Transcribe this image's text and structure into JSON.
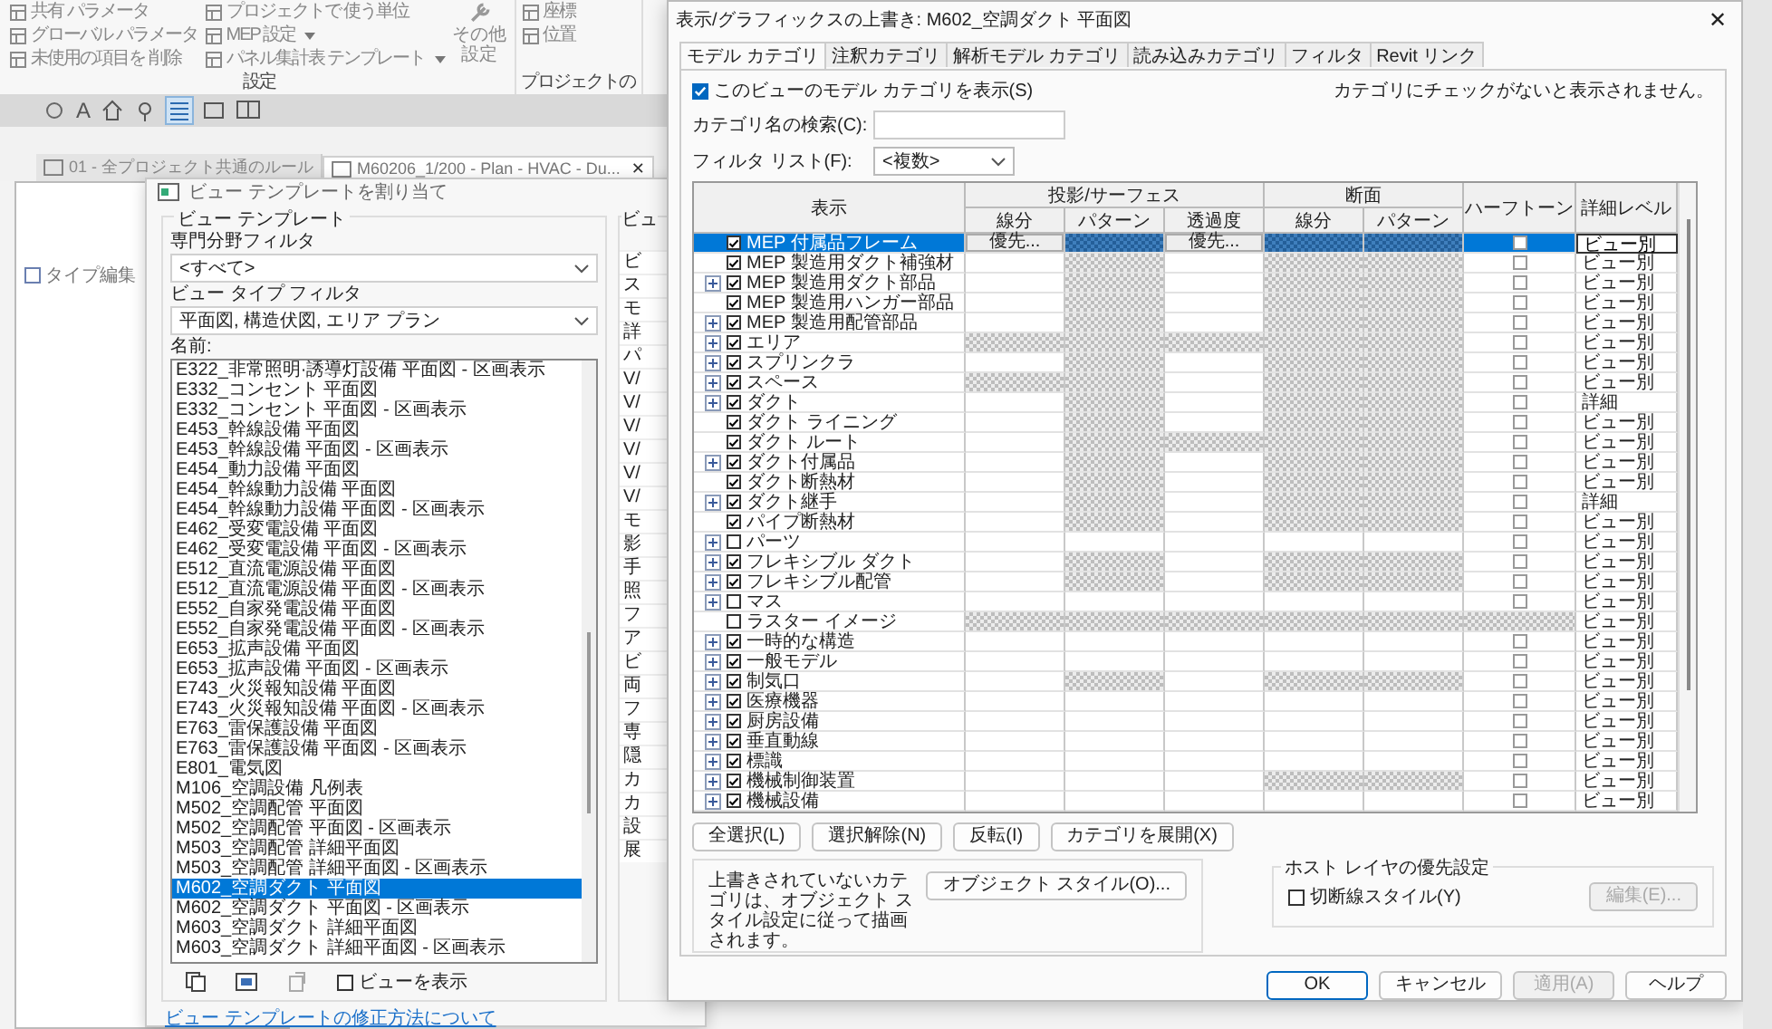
{
  "app": {
    "ribbon": {
      "groups": [
        {
          "label": "設定",
          "items": [
            {
              "label": "共有 パラメータ",
              "dropdown": false
            },
            {
              "label": "グローバル パラメータ",
              "dropdown": false
            },
            {
              "label": "未使用の項目を 削除",
              "dropdown": false
            },
            {
              "label": "プロジェクトで 使う単位",
              "dropdown": false
            },
            {
              "label": "MEP 設定",
              "dropdown": true
            },
            {
              "label": "パネル集計表 テンプレート",
              "dropdown": true
            }
          ],
          "big": "その他設定"
        },
        {
          "label": "プロジェクトの",
          "items": [
            {
              "label": "座標",
              "dropdown": false
            },
            {
              "label": "位置",
              "dropdown": false
            }
          ]
        }
      ]
    },
    "toolbar": {
      "text_tool": "A"
    },
    "doc_tabs": [
      {
        "label": "01 - 全プロジェクト共通のルール",
        "selected": false
      },
      {
        "label": "M60206_1/200 - Plan - HVAC - Du...",
        "selected": true,
        "close": "✕"
      }
    ],
    "side_panel": {
      "button": "タイプ編集"
    }
  },
  "template_dialog": {
    "title": "ビュー テンプレートを割り当て",
    "group_title": "ビュー テンプレート",
    "discipline_label": "専門分野フィルタ",
    "discipline_value": "<すべて>",
    "type_label": "ビュー タイプ フィルタ",
    "type_value": "平面図, 構造伏図, エリア プラン",
    "names_label": "名前:",
    "names": [
      {
        "label": "E322_非常照明·誘導灯設備 平面図 - 区画表示",
        "selected": false
      },
      {
        "label": "E332_コンセント 平面図",
        "selected": false
      },
      {
        "label": "E332_コンセント 平面図 - 区画表示",
        "selected": false
      },
      {
        "label": "E453_幹線設備 平面図",
        "selected": false
      },
      {
        "label": "E453_幹線設備 平面図 - 区画表示",
        "selected": false
      },
      {
        "label": "E454_動力設備 平面図",
        "selected": false
      },
      {
        "label": "E454_幹線動力設備 平面図",
        "selected": false
      },
      {
        "label": "E454_幹線動力設備 平面図 - 区画表示",
        "selected": false
      },
      {
        "label": "E462_受変電設備 平面図",
        "selected": false
      },
      {
        "label": "E462_受変電設備 平面図 - 区画表示",
        "selected": false
      },
      {
        "label": "E512_直流電源設備 平面図",
        "selected": false
      },
      {
        "label": "E512_直流電源設備 平面図 - 区画表示",
        "selected": false
      },
      {
        "label": "E552_自家発電設備 平面図",
        "selected": false
      },
      {
        "label": "E552_自家発電設備 平面図 - 区画表示",
        "selected": false
      },
      {
        "label": "E653_拡声設備 平面図",
        "selected": false
      },
      {
        "label": "E653_拡声設備 平面図 - 区画表示",
        "selected": false
      },
      {
        "label": "E743_火災報知設備 平面図",
        "selected": false
      },
      {
        "label": "E743_火災報知設備 平面図 - 区画表示",
        "selected": false
      },
      {
        "label": "E763_雷保護設備 平面図",
        "selected": false
      },
      {
        "label": "E763_雷保護設備 平面図 - 区画表示",
        "selected": false
      },
      {
        "label": "E801_電気図",
        "selected": false
      },
      {
        "label": "M106_空調設備 凡例表",
        "selected": false
      },
      {
        "label": "M502_空調配管 平面図",
        "selected": false
      },
      {
        "label": "M502_空調配管 平面図 - 区画表示",
        "selected": false
      },
      {
        "label": "M503_空調配管 詳細平面図",
        "selected": false
      },
      {
        "label": "M503_空調配管 詳細平面図 - 区画表示",
        "selected": false
      },
      {
        "label": "M602_空調ダクト 平面図",
        "selected": true
      },
      {
        "label": "M602_空調ダクト 平面図 - 区画表示",
        "selected": false
      },
      {
        "label": "M603_空調ダクト 詳細平面図",
        "selected": false
      },
      {
        "label": "M603_空調ダクト 詳細平面図 - 区画表示",
        "selected": false
      }
    ],
    "show_views": {
      "label": "ビューを表示",
      "checked": false
    },
    "help_link": "ビュー テンプレートの修正方法について",
    "side_group": {
      "title": "ビュ",
      "cut_rows": [
        "ビ",
        "ス",
        "モ",
        "詳",
        "パ",
        "V/",
        "V/",
        "V/",
        "V/",
        "V/",
        "V/",
        "モ",
        "影",
        "手",
        "照",
        "フ",
        "ア",
        "ビ",
        "両",
        "フ",
        "専",
        "隠",
        "カ",
        "カ",
        "設",
        "展"
      ]
    }
  },
  "overrides_dialog": {
    "title": "表示/グラフィックスの上書き: M602_空調ダクト 平面図",
    "close": "✕",
    "tabs": [
      {
        "label": "モデル カテゴリ",
        "selected": true
      },
      {
        "label": "注釈カテゴリ",
        "selected": false
      },
      {
        "label": "解析モデル カテゴリ",
        "selected": false
      },
      {
        "label": "読み込みカテゴリ",
        "selected": false
      },
      {
        "label": "フィルタ",
        "selected": false
      },
      {
        "label": "Revit リンク",
        "selected": false
      }
    ],
    "show_categories": {
      "label": "このビューのモデル カテゴリを表示(S)",
      "checked": true
    },
    "note": "カテゴリにチェックがないと表示されません。",
    "search_label": "カテゴリ名の検索(C):",
    "filter_label": "フィルタ リスト(F):",
    "filter_value": "<複数>",
    "table": {
      "headers": {
        "visibility": "表示",
        "projection": "投影/サーフェス",
        "cut": "断面",
        "halftone": "ハーフトーン",
        "detail": "詳細レベル",
        "sub": [
          "線分",
          "パターン",
          "透過度",
          "線分",
          "パターン"
        ]
      },
      "rows": [
        {
          "name": "MEP 付属品フレーム",
          "checked": true,
          "expandable": false,
          "selected": true,
          "detail": "ビュー別",
          "cells": [
            {
              "kind": "button",
              "text": "優先..."
            },
            {
              "kind": "hatched"
            },
            {
              "kind": "button",
              "text": "優先..."
            },
            {
              "kind": "hatched"
            },
            {
              "kind": "hatched"
            },
            {
              "kind": "checkbox",
              "checked": false
            }
          ]
        },
        {
          "name": "MEP 製造用ダクト補強材",
          "checked": true,
          "expandable": false,
          "selected": false,
          "detail": "ビュー別",
          "cells": [
            {
              "kind": "blank"
            },
            {
              "kind": "hatched"
            },
            {
              "kind": "blank"
            },
            {
              "kind": "hatched"
            },
            {
              "kind": "hatched"
            },
            {
              "kind": "checkbox",
              "checked": false
            }
          ]
        },
        {
          "name": "MEP 製造用ダクト部品",
          "checked": true,
          "expandable": true,
          "expanded": false,
          "selected": false,
          "detail": "ビュー別",
          "cells": [
            {
              "kind": "blank"
            },
            {
              "kind": "hatched"
            },
            {
              "kind": "blank"
            },
            {
              "kind": "hatched"
            },
            {
              "kind": "hatched"
            },
            {
              "kind": "checkbox",
              "checked": false
            }
          ]
        },
        {
          "name": "MEP 製造用ハンガー部品",
          "checked": true,
          "expandable": false,
          "selected": false,
          "detail": "ビュー別",
          "cells": [
            {
              "kind": "blank"
            },
            {
              "kind": "hatched"
            },
            {
              "kind": "blank"
            },
            {
              "kind": "hatched"
            },
            {
              "kind": "hatched"
            },
            {
              "kind": "checkbox",
              "checked": false
            }
          ]
        },
        {
          "name": "MEP 製造用配管部品",
          "checked": true,
          "expandable": true,
          "expanded": false,
          "selected": false,
          "detail": "ビュー別",
          "cells": [
            {
              "kind": "blank"
            },
            {
              "kind": "hatched"
            },
            {
              "kind": "blank"
            },
            {
              "kind": "hatched"
            },
            {
              "kind": "hatched"
            },
            {
              "kind": "checkbox",
              "checked": false
            }
          ]
        },
        {
          "name": "エリア",
          "checked": true,
          "expandable": true,
          "expanded": false,
          "selected": false,
          "detail": "ビュー別",
          "cells": [
            {
              "kind": "hatched"
            },
            {
              "kind": "hatched"
            },
            {
              "kind": "hatched"
            },
            {
              "kind": "hatched"
            },
            {
              "kind": "hatched"
            },
            {
              "kind": "checkbox",
              "checked": false
            }
          ]
        },
        {
          "name": "スプリンクラ",
          "checked": true,
          "expandable": true,
          "expanded": false,
          "selected": false,
          "detail": "ビュー別",
          "cells": [
            {
              "kind": "blank"
            },
            {
              "kind": "hatched"
            },
            {
              "kind": "blank"
            },
            {
              "kind": "hatched"
            },
            {
              "kind": "hatched"
            },
            {
              "kind": "checkbox",
              "checked": false
            }
          ]
        },
        {
          "name": "スペース",
          "checked": true,
          "expandable": true,
          "expanded": false,
          "selected": false,
          "detail": "ビュー別",
          "cells": [
            {
              "kind": "hatched"
            },
            {
              "kind": "hatched"
            },
            {
              "kind": "blank"
            },
            {
              "kind": "hatched"
            },
            {
              "kind": "hatched"
            },
            {
              "kind": "checkbox",
              "checked": false
            }
          ]
        },
        {
          "name": "ダクト",
          "checked": true,
          "expandable": true,
          "expanded": false,
          "selected": false,
          "detail": "詳細",
          "cells": [
            {
              "kind": "blank"
            },
            {
              "kind": "hatched"
            },
            {
              "kind": "blank"
            },
            {
              "kind": "hatched"
            },
            {
              "kind": "hatched"
            },
            {
              "kind": "checkbox",
              "checked": false
            }
          ]
        },
        {
          "name": "ダクト ライニング",
          "checked": true,
          "expandable": false,
          "selected": false,
          "detail": "ビュー別",
          "cells": [
            {
              "kind": "blank"
            },
            {
              "kind": "hatched"
            },
            {
              "kind": "blank"
            },
            {
              "kind": "hatched"
            },
            {
              "kind": "hatched"
            },
            {
              "kind": "checkbox",
              "checked": false
            }
          ]
        },
        {
          "name": "ダクト ルート",
          "checked": true,
          "expandable": false,
          "selected": false,
          "detail": "ビュー別",
          "cells": [
            {
              "kind": "blank"
            },
            {
              "kind": "hatched"
            },
            {
              "kind": "hatched"
            },
            {
              "kind": "hatched"
            },
            {
              "kind": "hatched"
            },
            {
              "kind": "checkbox",
              "checked": false
            }
          ]
        },
        {
          "name": "ダクト付属品",
          "checked": true,
          "expandable": true,
          "expanded": false,
          "selected": false,
          "detail": "ビュー別",
          "cells": [
            {
              "kind": "blank"
            },
            {
              "kind": "hatched"
            },
            {
              "kind": "blank"
            },
            {
              "kind": "hatched"
            },
            {
              "kind": "hatched"
            },
            {
              "kind": "checkbox",
              "checked": false
            }
          ]
        },
        {
          "name": "ダクト断熱材",
          "checked": true,
          "expandable": false,
          "selected": false,
          "detail": "ビュー別",
          "cells": [
            {
              "kind": "blank"
            },
            {
              "kind": "hatched"
            },
            {
              "kind": "blank"
            },
            {
              "kind": "hatched"
            },
            {
              "kind": "hatched"
            },
            {
              "kind": "checkbox",
              "checked": false
            }
          ]
        },
        {
          "name": "ダクト継手",
          "checked": true,
          "expandable": true,
          "expanded": false,
          "selected": false,
          "detail": "詳細",
          "cells": [
            {
              "kind": "blank"
            },
            {
              "kind": "hatched"
            },
            {
              "kind": "blank"
            },
            {
              "kind": "hatched"
            },
            {
              "kind": "hatched"
            },
            {
              "kind": "checkbox",
              "checked": false
            }
          ]
        },
        {
          "name": "パイプ断熱材",
          "checked": true,
          "expandable": false,
          "selected": false,
          "detail": "ビュー別",
          "cells": [
            {
              "kind": "blank"
            },
            {
              "kind": "hatched"
            },
            {
              "kind": "blank"
            },
            {
              "kind": "hatched"
            },
            {
              "kind": "hatched"
            },
            {
              "kind": "checkbox",
              "checked": false
            }
          ]
        },
        {
          "name": "パーツ",
          "checked": false,
          "expandable": true,
          "expanded": false,
          "selected": false,
          "detail": "ビュー別",
          "cells": [
            {
              "kind": "blank"
            },
            {
              "kind": "blank"
            },
            {
              "kind": "blank"
            },
            {
              "kind": "blank"
            },
            {
              "kind": "blank"
            },
            {
              "kind": "checkbox",
              "checked": false
            }
          ]
        },
        {
          "name": "フレキシブル ダクト",
          "checked": true,
          "expandable": true,
          "expanded": false,
          "selected": false,
          "detail": "ビュー別",
          "cells": [
            {
              "kind": "blank"
            },
            {
              "kind": "hatched"
            },
            {
              "kind": "blank"
            },
            {
              "kind": "hatched"
            },
            {
              "kind": "hatched"
            },
            {
              "kind": "checkbox",
              "checked": false
            }
          ]
        },
        {
          "name": "フレキシブル配管",
          "checked": true,
          "expandable": true,
          "expanded": false,
          "selected": false,
          "detail": "ビュー別",
          "cells": [
            {
              "kind": "blank"
            },
            {
              "kind": "hatched"
            },
            {
              "kind": "blank"
            },
            {
              "kind": "hatched"
            },
            {
              "kind": "hatched"
            },
            {
              "kind": "checkbox",
              "checked": false
            }
          ]
        },
        {
          "name": "マス",
          "checked": false,
          "expandable": true,
          "expanded": false,
          "selected": false,
          "detail": "ビュー別",
          "cells": [
            {
              "kind": "blank"
            },
            {
              "kind": "blank"
            },
            {
              "kind": "blank"
            },
            {
              "kind": "blank"
            },
            {
              "kind": "blank"
            },
            {
              "kind": "checkbox",
              "checked": false
            }
          ]
        },
        {
          "name": "ラスター イメージ",
          "checked": false,
          "expandable": false,
          "selected": false,
          "detail": "ビュー別",
          "cells": [
            {
              "kind": "hatched"
            },
            {
              "kind": "hatched"
            },
            {
              "kind": "hatched"
            },
            {
              "kind": "hatched"
            },
            {
              "kind": "hatched"
            },
            {
              "kind": "hatched"
            }
          ]
        },
        {
          "name": "一時的な構造",
          "checked": true,
          "expandable": true,
          "expanded": false,
          "selected": false,
          "detail": "ビュー別",
          "cells": [
            {
              "kind": "blank"
            },
            {
              "kind": "blank"
            },
            {
              "kind": "blank"
            },
            {
              "kind": "blank"
            },
            {
              "kind": "blank"
            },
            {
              "kind": "checkbox",
              "checked": false
            }
          ]
        },
        {
          "name": "一般モデル",
          "checked": true,
          "expandable": true,
          "expanded": false,
          "selected": false,
          "detail": "ビュー別",
          "cells": [
            {
              "kind": "blank"
            },
            {
              "kind": "blank"
            },
            {
              "kind": "blank"
            },
            {
              "kind": "blank"
            },
            {
              "kind": "blank"
            },
            {
              "kind": "checkbox",
              "checked": false
            }
          ]
        },
        {
          "name": "制気口",
          "checked": true,
          "expandable": true,
          "expanded": false,
          "selected": false,
          "detail": "ビュー別",
          "cells": [
            {
              "kind": "blank"
            },
            {
              "kind": "hatched"
            },
            {
              "kind": "blank"
            },
            {
              "kind": "hatched"
            },
            {
              "kind": "hatched"
            },
            {
              "kind": "checkbox",
              "checked": false
            }
          ]
        },
        {
          "name": "医療機器",
          "checked": true,
          "expandable": true,
          "expanded": false,
          "selected": false,
          "detail": "ビュー別",
          "cells": [
            {
              "kind": "blank"
            },
            {
              "kind": "blank"
            },
            {
              "kind": "blank"
            },
            {
              "kind": "blank"
            },
            {
              "kind": "blank"
            },
            {
              "kind": "checkbox",
              "checked": false
            }
          ]
        },
        {
          "name": "厨房設備",
          "checked": true,
          "expandable": true,
          "expanded": false,
          "selected": false,
          "detail": "ビュー別",
          "cells": [
            {
              "kind": "blank"
            },
            {
              "kind": "blank"
            },
            {
              "kind": "blank"
            },
            {
              "kind": "blank"
            },
            {
              "kind": "blank"
            },
            {
              "kind": "checkbox",
              "checked": false
            }
          ]
        },
        {
          "name": "垂直動線",
          "checked": true,
          "expandable": true,
          "expanded": false,
          "selected": false,
          "detail": "ビュー別",
          "cells": [
            {
              "kind": "blank"
            },
            {
              "kind": "blank"
            },
            {
              "kind": "blank"
            },
            {
              "kind": "blank"
            },
            {
              "kind": "blank"
            },
            {
              "kind": "checkbox",
              "checked": false
            }
          ]
        },
        {
          "name": "標識",
          "checked": true,
          "expandable": true,
          "expanded": false,
          "selected": false,
          "detail": "ビュー別",
          "cells": [
            {
              "kind": "blank"
            },
            {
              "kind": "blank"
            },
            {
              "kind": "blank"
            },
            {
              "kind": "blank"
            },
            {
              "kind": "blank"
            },
            {
              "kind": "checkbox",
              "checked": false
            }
          ]
        },
        {
          "name": "機械制御装置",
          "checked": true,
          "expandable": true,
          "expanded": false,
          "selected": false,
          "detail": "ビュー別",
          "cells": [
            {
              "kind": "blank"
            },
            {
              "kind": "blank"
            },
            {
              "kind": "blank"
            },
            {
              "kind": "hatched"
            },
            {
              "kind": "hatched"
            },
            {
              "kind": "checkbox",
              "checked": false
            }
          ]
        },
        {
          "name": "機械設備",
          "checked": true,
          "expandable": true,
          "expanded": false,
          "selected": false,
          "detail": "ビュー別",
          "cells": [
            {
              "kind": "blank"
            },
            {
              "kind": "blank"
            },
            {
              "kind": "blank"
            },
            {
              "kind": "blank"
            },
            {
              "kind": "blank"
            },
            {
              "kind": "checkbox",
              "checked": false
            }
          ]
        }
      ]
    },
    "table_buttons": [
      "全選択(L)",
      "選択解除(N)",
      "反転(I)",
      "カテゴリを展開(X)"
    ],
    "info_text": "上書きされていないカテゴリは、オブジェクト スタイル設定に従って描画されます。",
    "object_styles_button": "オブジェクト スタイル(O)...",
    "host_group": {
      "title": "ホスト レイヤの優先設定",
      "checkbox": {
        "label": "切断線スタイル(Y)",
        "checked": false
      },
      "edit": {
        "label": "編集(E)...",
        "disabled": true
      }
    },
    "footer": [
      {
        "label": "OK",
        "default": true,
        "disabled": false
      },
      {
        "label": "キャンセル",
        "default": false,
        "disabled": false
      },
      {
        "label": "適用(A)",
        "default": false,
        "disabled": true
      },
      {
        "label": "ヘルプ",
        "default": false,
        "disabled": false
      }
    ]
  }
}
